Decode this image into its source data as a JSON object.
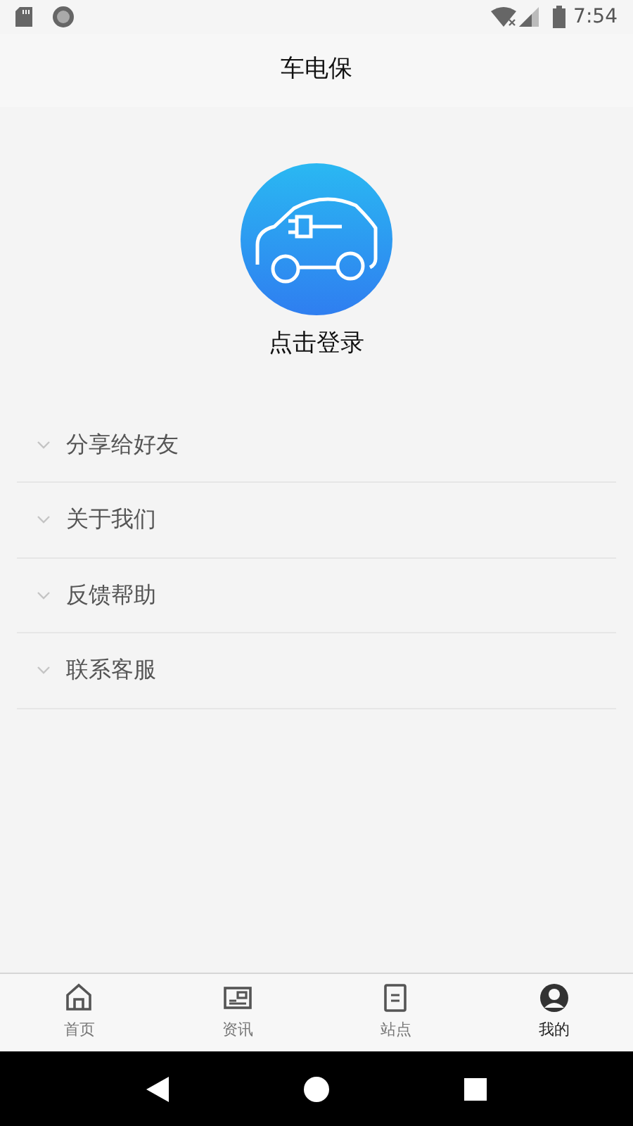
{
  "status_bar": {
    "time": "7:54"
  },
  "header": {
    "title": "车电保"
  },
  "profile": {
    "login_label": "点击登录"
  },
  "menu": [
    {
      "label": "分享给好友",
      "expanded": false
    },
    {
      "label": "关于我们",
      "expanded": false
    },
    {
      "label": "反馈帮助",
      "expanded": false
    },
    {
      "label": "联系客服",
      "expanded": false
    }
  ],
  "tabs": [
    {
      "label": "首页",
      "kind": "home",
      "selected": false
    },
    {
      "label": "资讯",
      "kind": "news",
      "selected": false
    },
    {
      "label": "站点",
      "kind": "doc",
      "selected": false
    },
    {
      "label": "我的",
      "kind": "user",
      "selected": true
    }
  ]
}
